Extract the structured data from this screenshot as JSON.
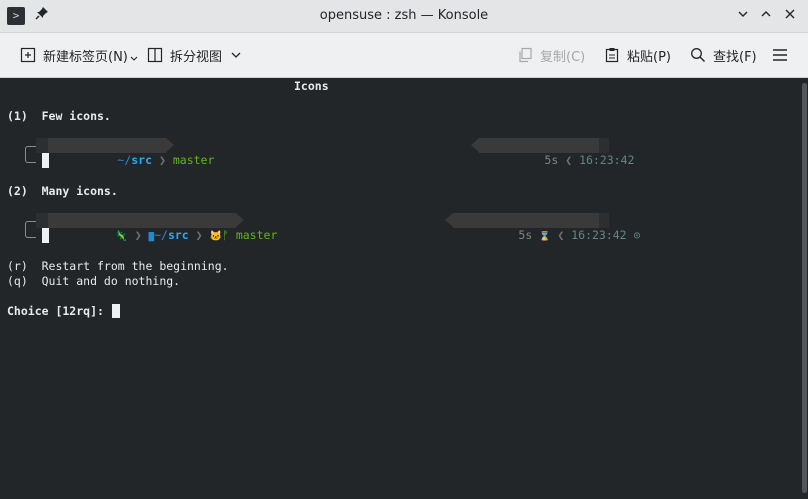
{
  "window": {
    "title": "opensuse : zsh — Konsole"
  },
  "icons": {
    "app": "konsole-icon",
    "pin": "pin-icon",
    "minimize": "chevron-down-icon",
    "maximize": "chevron-up-icon",
    "close": "close-icon",
    "new_tab": "new-tab-icon",
    "split_view": "split-view-icon",
    "copy": "copy-icon",
    "paste": "paste-icon",
    "find": "search-icon",
    "menu": "hamburger-menu-icon"
  },
  "toolbar": {
    "new_tab_label": "新建标签页(N)",
    "split_view_label": "拆分视图",
    "copy_label": "复制(C)",
    "paste_label": "粘贴(P)",
    "find_label": "查找(F)"
  },
  "terminal": {
    "heading": "Icons",
    "option1": "(1)  Few icons.",
    "option2": "(2)  Many icons.",
    "restart": "(r)  Restart from the beginning.",
    "quit": "(q)  Quit and do nothing.",
    "choice_prompt": "Choice [12rq]: "
  },
  "prompt_few": {
    "dir_prefix": "~/",
    "dir": "src",
    "separator": "❯",
    "branch": "master",
    "duration": "5s",
    "right_separator": "❮",
    "time": "16:23:42"
  },
  "prompt_many": {
    "os_icon": "🦎",
    "folder_icon": "▇",
    "dir_prefix": "~/",
    "dir": "src",
    "separator": "❯",
    "git_icon": "🐱",
    "branch_icon": "ᚠ",
    "branch": "master",
    "duration": "5s",
    "hourglass_icon": "⌛",
    "right_separator": "❮",
    "time": "16:23:42",
    "clock_icon": "⊙"
  },
  "colors": {
    "background": "#232629",
    "segment_bg": "#3a3a3a",
    "dir": "#2ea7f0",
    "git": "#5fb51f",
    "time": "#5f8787"
  }
}
